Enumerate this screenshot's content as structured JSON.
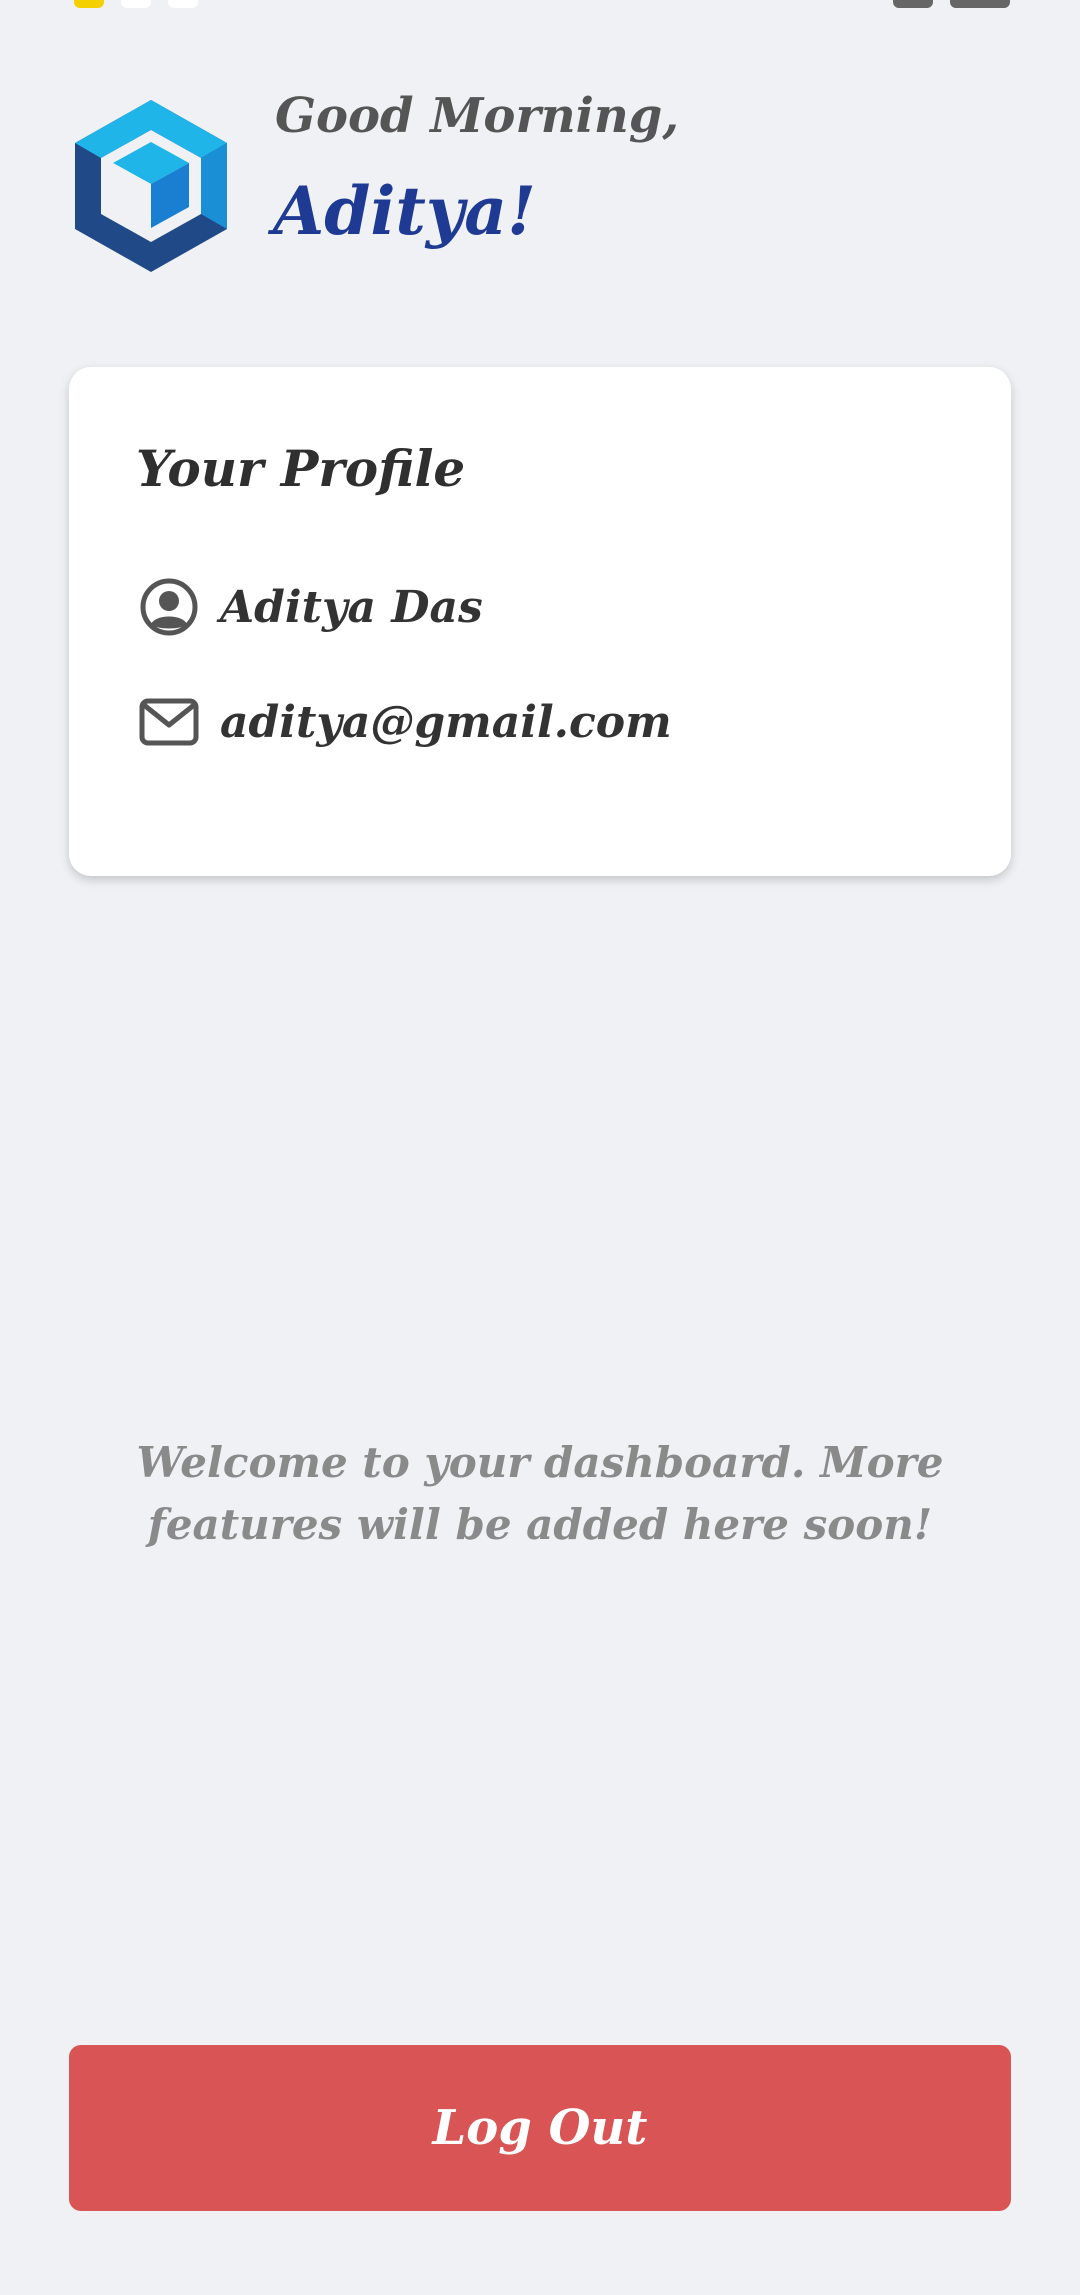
{
  "header": {
    "greeting": "Good Morning,",
    "user_first_name": "Aditya!",
    "logo_icon": "cube-logo-icon"
  },
  "profile_card": {
    "title": "Your Profile",
    "name": "Aditya Das",
    "email": "aditya@gmail.com",
    "name_icon": "user-circle-icon",
    "email_icon": "mail-icon"
  },
  "welcome_message": "Welcome to your dashboard. More features will be added here soon!",
  "logout": {
    "label": "Log Out"
  },
  "colors": {
    "background": "#eff1f5",
    "accent_blue": "#1f3a93",
    "logout_red": "#d95454",
    "logo_light": "#1fb5e8",
    "logo_dark": "#1f4a87"
  }
}
